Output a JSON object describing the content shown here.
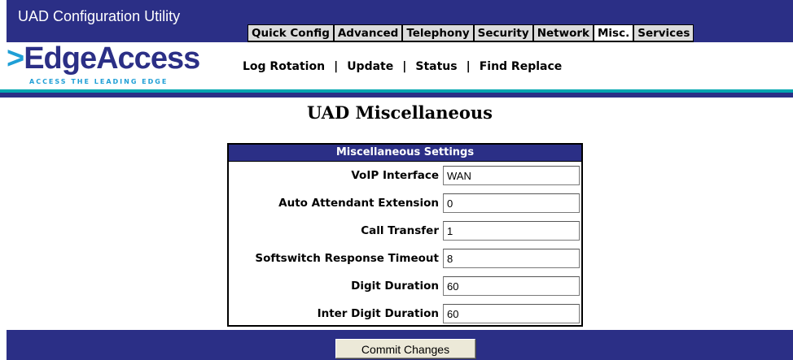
{
  "header": {
    "app_title": "UAD Configuration Utility",
    "logo": {
      "chevron": ">",
      "wordmark": "EdgeAccess",
      "tagline": "ACCESS THE LEADING EDGE"
    },
    "main_nav": [
      {
        "label": "Quick Config",
        "active": false
      },
      {
        "label": "Advanced",
        "active": false
      },
      {
        "label": "Telephony",
        "active": false
      },
      {
        "label": "Security",
        "active": false
      },
      {
        "label": "Network",
        "active": false
      },
      {
        "label": "Misc.",
        "active": true
      },
      {
        "label": "Services",
        "active": false
      }
    ],
    "sub_nav": [
      "Log Rotation",
      "Update",
      "Status",
      "Find Replace"
    ],
    "sub_nav_separator": "|"
  },
  "main": {
    "heading": "UAD Miscellaneous",
    "panel": {
      "title": "Miscellaneous Settings",
      "fields": [
        {
          "label": "VoIP Interface",
          "value": "WAN"
        },
        {
          "label": "Auto Attendant Extension",
          "value": "0"
        },
        {
          "label": "Call Transfer",
          "value": "1"
        },
        {
          "label": "Softswitch Response Timeout",
          "value": "8"
        },
        {
          "label": "Digit Duration",
          "value": "60"
        },
        {
          "label": "Inter Digit Duration",
          "value": "60"
        }
      ]
    }
  },
  "footer": {
    "commit_label": "Commit Changes"
  },
  "colors": {
    "navy": "#2b2f86",
    "teal": "#00a6b0",
    "logo_blue": "#1f9fd6",
    "tab_bg": "#dcdcdc"
  }
}
